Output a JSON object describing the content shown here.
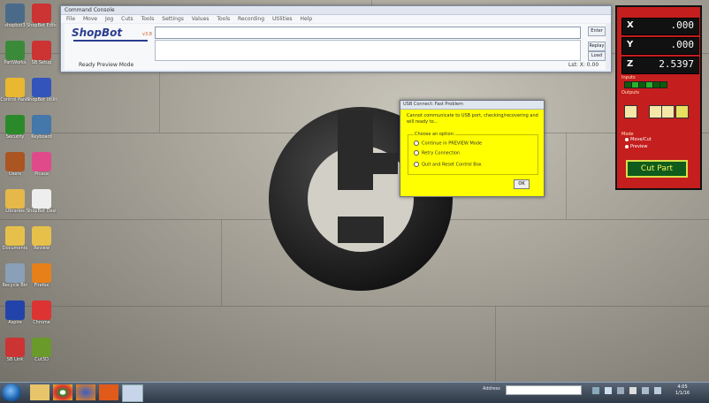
{
  "console": {
    "title": "Command Console",
    "menu": [
      "File",
      "Move",
      "Jog",
      "Cuts",
      "Tools",
      "Settings",
      "Values",
      "Tools",
      "Recording",
      "Utilities",
      "Help"
    ],
    "logo": "ShopBot",
    "logo_version": "v3.8",
    "buttons": {
      "enter": "Enter",
      "replay": "Replay",
      "load": "Load"
    },
    "status_left": "Ready   Preview Mode",
    "status_right": "Lst: X: 0.00"
  },
  "dialog": {
    "title": "USB Connect: Fast Problem",
    "message": "Cannot communicate to USB port, checking/recovering and will ready to...",
    "group_label": "Choose an option:",
    "options": [
      "Continue in PREVIEW Mode",
      "Retry Connection",
      "Quit and Reset Control Box"
    ],
    "ok": "OK"
  },
  "dro": {
    "x_label": "X",
    "x_value": ".000",
    "y_label": "Y",
    "y_value": ".000",
    "z_label": "Z",
    "z_value": "2.5397",
    "inputs_label": "Inputs",
    "outputs_label": "Outputs",
    "mode_label": "Mode",
    "mode_options": [
      "Move/Cut",
      "Preview"
    ],
    "cut_button": "Cut Part"
  },
  "desktop_icons": [
    {
      "label": "shopbot3",
      "color": "#4a6a8a"
    },
    {
      "label": "ShopBot Editor",
      "color": "#c33"
    },
    {
      "label": "PartWorks",
      "color": "#3a8a3a"
    },
    {
      "label": "SB Setup",
      "color": "#c33"
    },
    {
      "label": "Control Panel",
      "color": "#e8b830"
    },
    {
      "label": "ShopBot Utilities",
      "color": "#3355bb"
    },
    {
      "label": "Security",
      "color": "#2a8a2a"
    },
    {
      "label": "Keyboard",
      "color": "#4477aa"
    },
    {
      "label": "Users",
      "color": "#aa5522"
    },
    {
      "label": "Picasa",
      "color": "#e04a8a"
    },
    {
      "label": "Libraries",
      "color": "#e6b84a"
    },
    {
      "label": "ShopBot Designer",
      "color": "#eee"
    },
    {
      "label": "Documents",
      "color": "#e6c04a"
    },
    {
      "label": "Review",
      "color": "#e6c04a"
    },
    {
      "label": "Recycle Bin",
      "color": "#8aa0b8"
    },
    {
      "label": "Firefox",
      "color": "#e8801a"
    },
    {
      "label": "Aspire",
      "color": "#2244aa"
    },
    {
      "label": "Chrome",
      "color": "#d33"
    },
    {
      "label": "SB Link",
      "color": "#c33"
    },
    {
      "label": "Cut3D",
      "color": "#6a9a2a"
    }
  ],
  "taskbar": {
    "address_label": "Address",
    "time": "4:05",
    "date": "1/1/16"
  }
}
